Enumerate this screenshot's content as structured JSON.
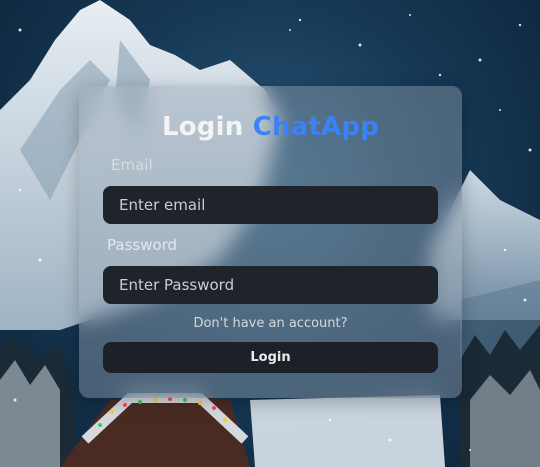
{
  "login": {
    "title_prefix": "Login",
    "title_brand": "ChatApp",
    "email_label": "Email",
    "email_placeholder": "Enter email",
    "email_value": "",
    "password_label": "Password",
    "password_placeholder": "Enter Password",
    "password_value": "",
    "signup_link": "Don't have an account?",
    "login_button": "Login"
  },
  "colors": {
    "brand": "#3b82f6",
    "card_bg": "rgba(150,165,178,0.42)",
    "input_bg": "#1f232a",
    "button_bg": "#1d2127",
    "sky": "#173a57"
  }
}
